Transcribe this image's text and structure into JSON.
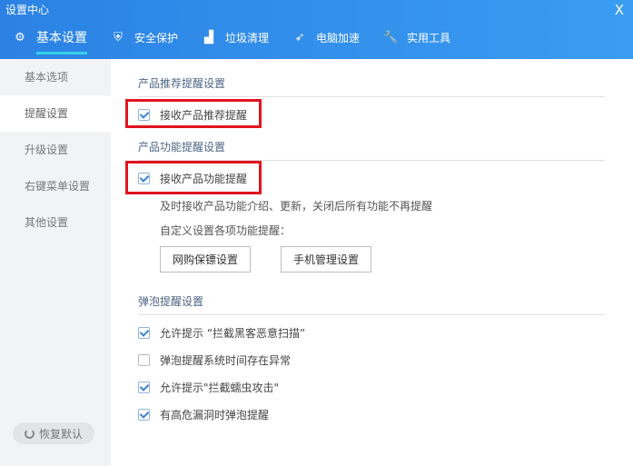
{
  "window": {
    "title": "设置中心",
    "close": "X"
  },
  "tabs": [
    {
      "label": "基本设置",
      "icon": "gear-icon"
    },
    {
      "label": "安全保护",
      "icon": "shield-icon"
    },
    {
      "label": "垃圾清理",
      "icon": "broom-icon"
    },
    {
      "label": "电脑加速",
      "icon": "rocket-icon"
    },
    {
      "label": "实用工具",
      "icon": "wrench-icon"
    }
  ],
  "sidebar": {
    "items": [
      "基本选项",
      "提醒设置",
      "升级设置",
      "右键菜单设置",
      "其他设置"
    ],
    "restore": "恢复默认"
  },
  "sections": {
    "recommend": {
      "title": "产品推荐提醒设置",
      "option": "接收产品推荐提醒",
      "checked": true
    },
    "feature": {
      "title": "产品功能提醒设置",
      "option": "接收产品功能提醒",
      "checked": true,
      "desc": "及时接收产品功能介绍、更新，关闭后所有功能不再提醒",
      "custom": "自定义设置各项功能提醒：",
      "btn1": "网购保镖设置",
      "btn2": "手机管理设置"
    },
    "popup": {
      "title": "弹泡提醒设置",
      "options": [
        {
          "label": "允许提示 “拦截黑客恶意扫描”",
          "checked": true
        },
        {
          "label": "弹泡提醒系统时间存在异常",
          "checked": false
        },
        {
          "label": "允许提示\"拦截蠕虫攻击\"",
          "checked": true
        },
        {
          "label": "有高危漏洞时弹泡提醒",
          "checked": true
        }
      ]
    }
  },
  "colors": {
    "accent": "#2b82e4",
    "highlight": "#e0141e"
  }
}
